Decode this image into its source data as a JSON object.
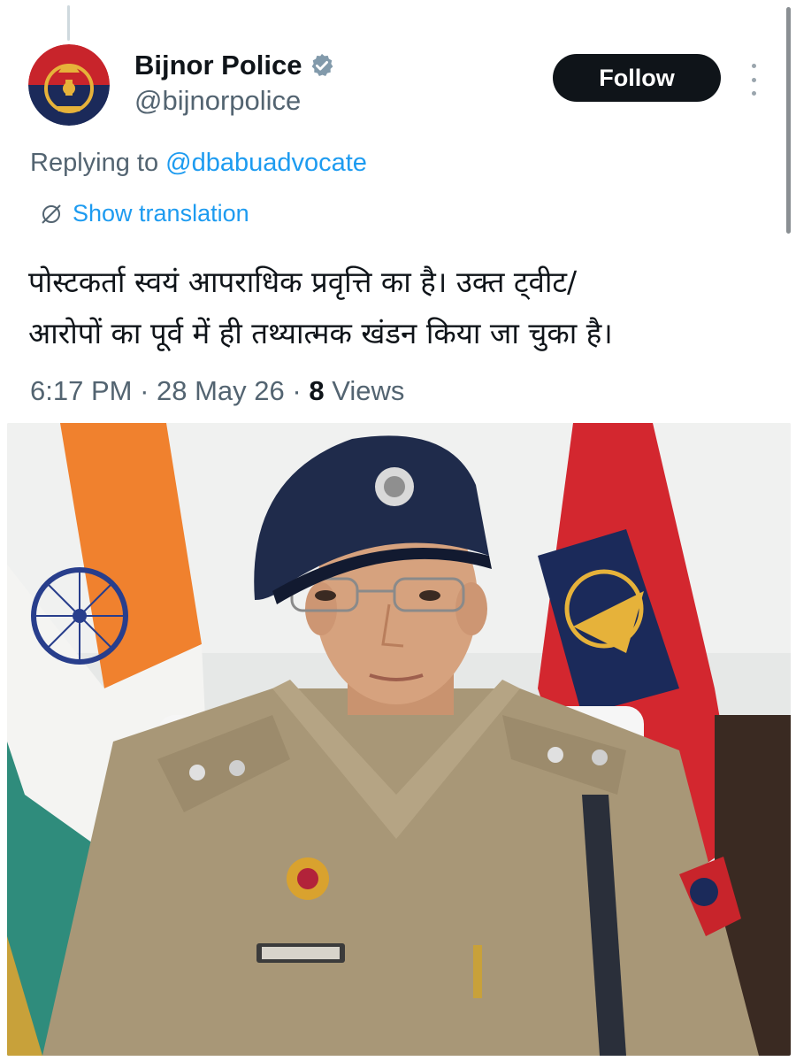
{
  "header": {
    "display_name": "Bijnor Police",
    "handle": "@bijnorpolice",
    "follow_label": "Follow"
  },
  "reply": {
    "prefix": "Replying to ",
    "mention": "@dbabuadvocate"
  },
  "translation_label": "Show translation",
  "tweet": {
    "line1": "पोस्टकर्ता स्वयं आपराधिक प्रवृत्ति का है। उक्त ट्वीट/",
    "line2": "आरोपों का पूर्व में ही तथ्यात्मक खंडन किया जा चुका है।"
  },
  "meta": {
    "time": "6:17 PM",
    "date": "28 May 26",
    "views_count": "8",
    "views_label": "Views"
  },
  "colors": {
    "accent": "#1d9bf0",
    "secondary_text": "#536471",
    "follow_bg": "#0f1419"
  },
  "icons": {
    "verified": "verified-badge-icon",
    "translate": "globe-translate-icon",
    "more": "more-vertical-icon"
  }
}
